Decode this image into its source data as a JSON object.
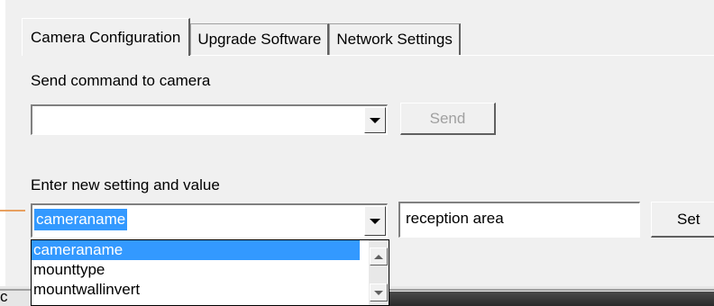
{
  "tabs": [
    {
      "label": "Camera Configuration",
      "active": true
    },
    {
      "label": "Upgrade Software",
      "active": false
    },
    {
      "label": "Network Settings",
      "active": false
    }
  ],
  "send_command": {
    "label": "Send command to camera",
    "value": "",
    "button_label": "Send"
  },
  "new_setting": {
    "label": "Enter new setting and value",
    "setting_value": "cameraname",
    "value_text": "reception area",
    "button_label": "Set"
  },
  "setting_options": [
    "cameraname",
    "mounttype",
    "mountwallinvert"
  ],
  "partial_text": "c",
  "colors": {
    "selection": "#3399ff",
    "window_bg": "#f0f0f0"
  }
}
